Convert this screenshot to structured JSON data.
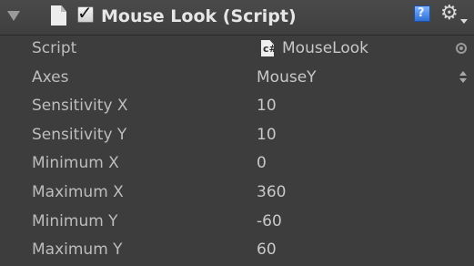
{
  "component": {
    "title": "Mouse Look (Script)",
    "enabled": true,
    "icons": {
      "foldout": "triangle-down-icon",
      "script": "script-file-icon",
      "help": "help-icon",
      "settings": "gear-icon"
    }
  },
  "fields": {
    "script": {
      "label": "Script",
      "value": "MouseLook",
      "icon_glyph": "c#"
    },
    "axes": {
      "label": "Axes",
      "value": "MouseY"
    },
    "sensitivity_x": {
      "label": "Sensitivity X",
      "value": "10"
    },
    "sensitivity_y": {
      "label": "Sensitivity Y",
      "value": "10"
    },
    "minimum_x": {
      "label": "Minimum X",
      "value": "0"
    },
    "maximum_x": {
      "label": "Maximum X",
      "value": "360"
    },
    "minimum_y": {
      "label": "Minimum Y",
      "value": "-60"
    },
    "maximum_y": {
      "label": "Maximum Y",
      "value": "60"
    }
  },
  "colors": {
    "background": "#3d3d3d",
    "text": "#c8c8c8",
    "title": "#e6e6e6",
    "help_blue": "#2f6fd6"
  }
}
